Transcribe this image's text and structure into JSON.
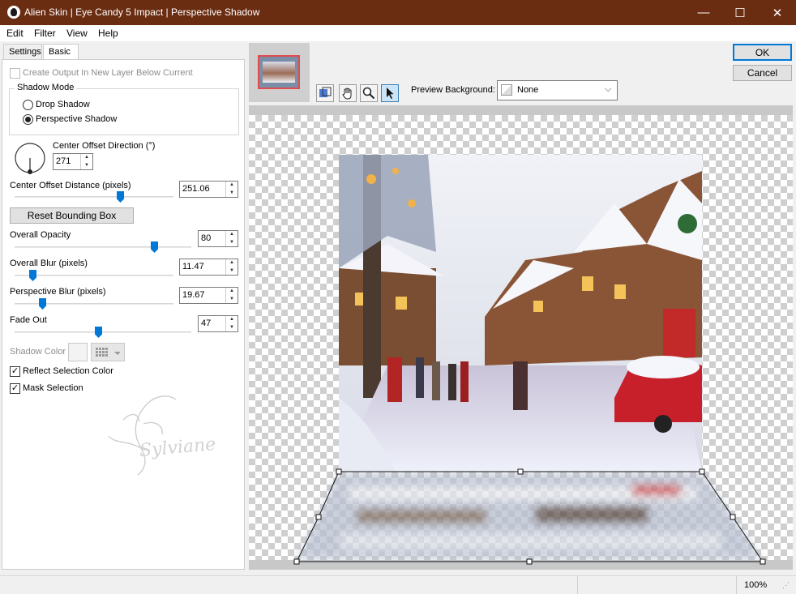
{
  "window": {
    "title": "Alien Skin | Eye Candy 5 Impact | Perspective Shadow",
    "minimize": "—",
    "maximize": "☐",
    "close": "✕"
  },
  "menu": [
    "Edit",
    "Filter",
    "View",
    "Help"
  ],
  "tabs": [
    "Settings",
    "Basic"
  ],
  "basic": {
    "create_output_label": "Create Output In New Layer Below Current",
    "shadow_mode_label": "Shadow Mode",
    "drop_shadow_label": "Drop Shadow",
    "perspective_shadow_label": "Perspective Shadow",
    "center_offset_direction_label": "Center Offset Direction (°)",
    "center_offset_direction_value": "271",
    "center_offset_distance_label": "Center Offset Distance (pixels)",
    "center_offset_distance_value": "251.06",
    "reset_bounding_box_label": "Reset Bounding Box",
    "overall_opacity_label": "Overall Opacity",
    "overall_opacity_value": "80",
    "overall_blur_label": "Overall Blur (pixels)",
    "overall_blur_value": "11.47",
    "perspective_blur_label": "Perspective Blur (pixels)",
    "perspective_blur_value": "19.67",
    "fade_out_label": "Fade Out",
    "fade_out_value": "47",
    "shadow_color_label": "Shadow Color",
    "reflect_selection_color_label": "Reflect Selection Color",
    "mask_selection_label": "Mask Selection",
    "watermark_text": "Sylviane"
  },
  "buttons": {
    "ok": "OK",
    "cancel": "Cancel"
  },
  "preview": {
    "background_label": "Preview Background:",
    "background_value": "None"
  },
  "status": {
    "zoom": "100%"
  },
  "colors": {
    "titlebar": "#6b2d12",
    "accent": "#0078d7",
    "thumbnail_border": "#e24b4b"
  }
}
